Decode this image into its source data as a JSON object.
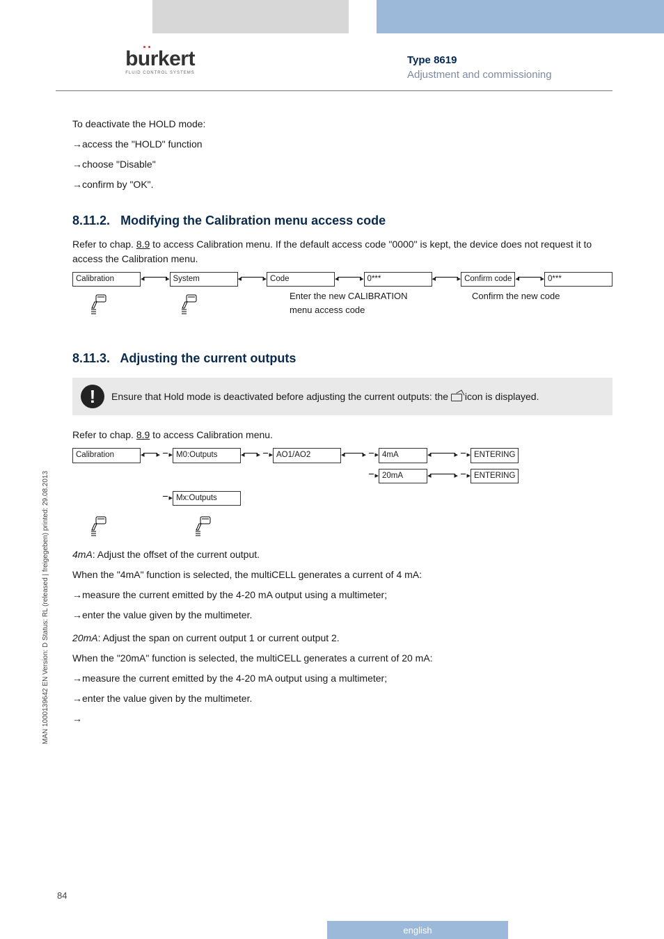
{
  "header": {
    "logo_text": "burkert",
    "logo_sub": "FLUID CONTROL SYSTEMS",
    "type_label": "Type 8619",
    "subtitle": "Adjustment and commissioning"
  },
  "intro": {
    "deactivate": "To deactivate the HOLD mode:",
    "s1": "access the \"HOLD\" function",
    "s2": "choose \"Disable\"",
    "s3": "confirm by \"OK\"."
  },
  "sec1": {
    "num": "8.11.2.",
    "title": "Modifying the Calibration menu access code",
    "lead_a": "Refer to chap. ",
    "lead_link": "8.9",
    "lead_b": " to access Calibration menu. If the default access code \"0000\" is kept, the device does not request it to access the Calibration menu.",
    "flow": {
      "n1": "Calibration",
      "n2": "System",
      "n3": "Code",
      "n4": "0***",
      "n5": "Confirm code",
      "n6": "0***",
      "cap1": "Enter the new CALIBRATION menu access code",
      "cap2": "Confirm the new code"
    }
  },
  "sec2": {
    "num": "8.11.3.",
    "title": "Adjusting the current outputs",
    "note_a": "Ensure that Hold mode is deactivated before adjusting the current outputs: the ",
    "note_b": " icon  is displayed.",
    "lead_a": "Refer to chap. ",
    "lead_link": "8.9",
    "lead_b": " to access Calibration menu.",
    "flow": {
      "n1": "Calibration",
      "n2": "M0:Outputs",
      "n3": "AO1/AO2",
      "n4a": "4mA",
      "n4b": "20mA",
      "n5": "ENTERING",
      "nX": "Mx:Outputs"
    },
    "p1": "4mA: Adjust the offset of the current output.",
    "p1_em": "4mA",
    "p2": "When the \"4mA\" function is selected, the multiCELL generates a current of 4 mA:",
    "p3": "measure the current emitted by the 4-20 mA output using a multimeter;",
    "p4": "enter the value given by the multimeter.",
    "p5": "20mA: Adjust the span on current output 1 or current output 2.",
    "p5_em": "20mA",
    "p6": "When the \"20mA\" function is selected, the multiCELL generates a current of 20 mA:",
    "p7": "measure the current emitted by the 4-20 mA output using a multimeter;",
    "p8": "enter the value given by the multimeter."
  },
  "side_text": "MAN 1000139642 EN Version: D Status: RL (released | freigegeben) printed: 29.08.2013",
  "page_number": "84",
  "footer_lang": "english"
}
